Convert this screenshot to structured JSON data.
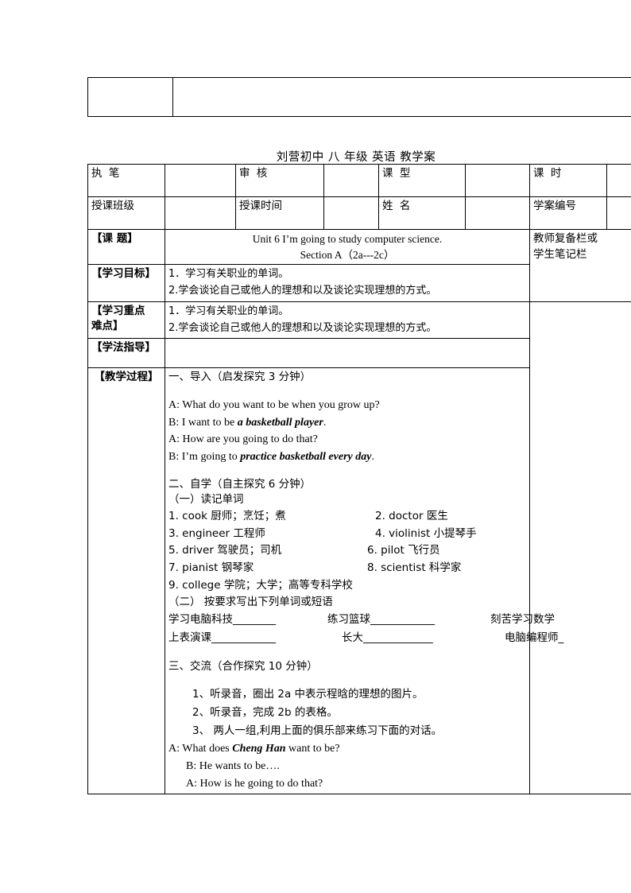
{
  "document": {
    "title_line": "刘营初中   八     年级   英语    教学案"
  },
  "top_table": {
    "cell_left": "",
    "cell_right": ""
  },
  "meta": {
    "row1": [
      {
        "label": "执  笔",
        "value": ""
      },
      {
        "label": "审   核",
        "value": ""
      },
      {
        "label": "课   型",
        "value": ""
      },
      {
        "label": "课    时",
        "value": ""
      }
    ],
    "row2": [
      {
        "label": "授课班级",
        "value": ""
      },
      {
        "label": "授课时间",
        "value": ""
      },
      {
        "label": "姓   名",
        "value": ""
      },
      {
        "label": "学案编号",
        "value": ""
      }
    ]
  },
  "notes_column": {
    "line1": "教师复备栏或",
    "line2": "学生笔记栏"
  },
  "sections": {
    "topic": {
      "label": "【课    题】",
      "line1": "Unit 6 I’m going to study computer science.",
      "line2": "Section A（2a---2c）"
    },
    "objectives": {
      "label": "【学习目标】",
      "line1": "1．学习有关职业的单词。",
      "line2": "2.学会谈论自己或他人的理想和以及谈论实现理想的方式。"
    },
    "key_points": {
      "label_line1": "【学习重点",
      "label_line2": "难点】",
      "line1": "1．学习有关职业的单词。",
      "line2": "2.学会谈论自己或他人的理想和以及谈论实现理想的方式。"
    },
    "method_guide": {
      "label": "【学法指导】",
      "content": ""
    },
    "process": {
      "label": "【教学过程】"
    }
  },
  "lesson": {
    "part1": {
      "heading": "一、导入（启发探究   3 分钟）",
      "dialog": [
        {
          "speaker": "A:",
          "plain1": " What do you want to be when you grow up?",
          "em": "",
          "plain2": ""
        },
        {
          "speaker": "B:",
          "plain1": " I want to be ",
          "em": "a basketball player",
          "plain2": "."
        },
        {
          "speaker": "A:",
          "plain1": " How are you going to do that?",
          "em": "",
          "plain2": ""
        },
        {
          "speaker": "B:",
          "plain1": " I’m going to ",
          "em": "practice basketball every day",
          "plain2": "."
        }
      ]
    },
    "part2": {
      "heading": "二、自学（自主探究   6 分钟）",
      "sub1": "（一）读记单词",
      "vocab": [
        {
          "left": "1. cook  厨师；烹饪；煮",
          "right": "2. doctor  医生"
        },
        {
          "left": "3. engineer  工程师",
          "right": "4. violinist  小提琴手"
        },
        {
          "left": "5. driver  驾驶员；司机",
          "right": "6. pilot  飞行员"
        },
        {
          "left": "7. pianist  钢琴家",
          "right": "8. scientist  科学家"
        },
        {
          "left": "9. college  学院；大学；高等专科学校",
          "right": ""
        }
      ],
      "sub2": "（二） 按要求写出下列单词或短语",
      "fill_rows": [
        {
          "a": "学习电脑科技________",
          "b": "练习篮球____________",
          "c": "刻苦学习数学"
        },
        {
          "a": "上表演课____________",
          "b": "长大_____________",
          "c": "电脑编程师_"
        }
      ]
    },
    "part3": {
      "heading": "三、交流（合作探究   10 分钟）",
      "tasks": [
        "1、听录音，圈出 2a 中表示程晗的理想的图片。",
        "2、听录音，完成 2b 的表格。",
        "3、 两人一组,利用上面的俱乐部来练习下面的对话。"
      ],
      "dialog": [
        {
          "indent": 0,
          "speaker": "A:",
          "plain1": " What does ",
          "em": "Cheng Han",
          "plain2": " want to be?"
        },
        {
          "indent": 1,
          "speaker": "B:",
          "plain1": " He wants to be….",
          "em": "",
          "plain2": ""
        },
        {
          "indent": 1,
          "speaker": "A:",
          "plain1": " How is he going to do that?",
          "em": "",
          "plain2": ""
        }
      ]
    }
  }
}
